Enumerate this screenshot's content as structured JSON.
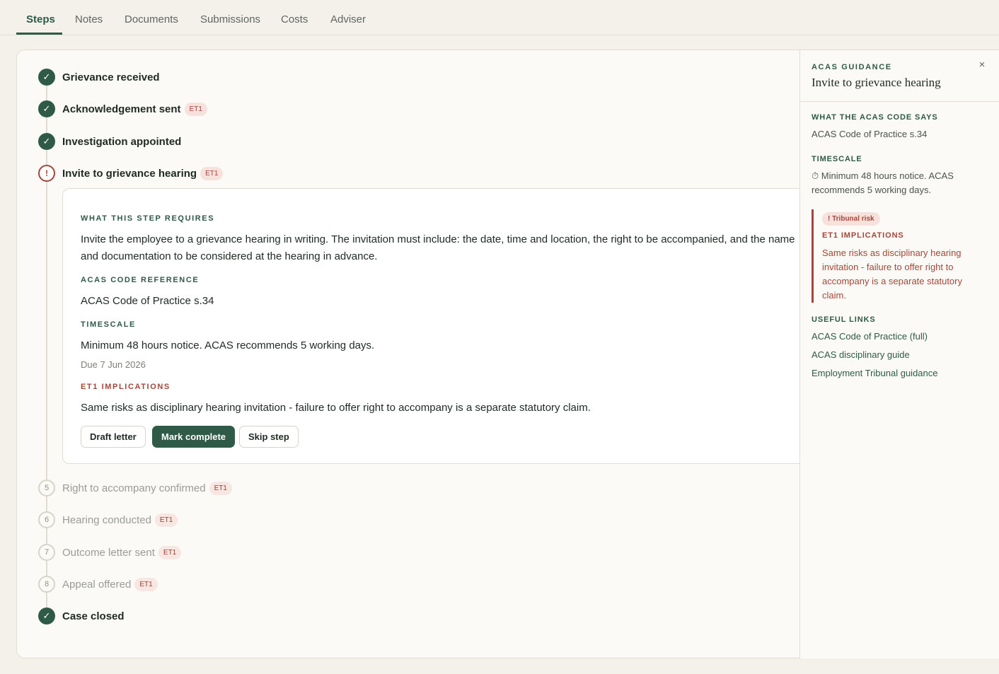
{
  "tabs": [
    {
      "label": "Steps"
    },
    {
      "label": "Notes"
    },
    {
      "label": "Documents"
    },
    {
      "label": "Submissions"
    },
    {
      "label": "Costs"
    },
    {
      "label": "Adviser"
    }
  ],
  "steps": [
    {
      "marker": "✓",
      "label": "Grievance received",
      "status": "done",
      "badge": ""
    },
    {
      "marker": "✓",
      "label": "Acknowledgement sent",
      "status": "done",
      "badge": "ET1"
    },
    {
      "marker": "✓",
      "label": "Investigation appointed",
      "status": "done",
      "badge": ""
    },
    {
      "marker": "!",
      "label": "Invite to grievance hearing",
      "status": "current",
      "badge": "ET1"
    },
    {
      "marker": "5",
      "label": "Right to accompany confirmed",
      "status": "pending",
      "badge": "ET1"
    },
    {
      "marker": "6",
      "label": "Hearing conducted",
      "status": "pending",
      "badge": "ET1"
    },
    {
      "marker": "7",
      "label": "Outcome letter sent",
      "status": "pending",
      "badge": "ET1"
    },
    {
      "marker": "8",
      "label": "Appeal offered",
      "status": "pending",
      "badge": "ET1"
    },
    {
      "marker": "✓",
      "label": "Case closed",
      "status": "done",
      "badge": ""
    }
  ],
  "detail": {
    "requires_heading": "WHAT THIS STEP REQUIRES",
    "requires_line1": "Invite the employee to a grievance hearing in writing. The invitation must include: the date, time and location, the right to be accompanied, and the name",
    "requires_line2": "and documentation to be considered at the hearing in advance.",
    "acas_heading": "ACAS CODE REFERENCE",
    "acas_text": "ACAS Code of Practice s.34",
    "timescale_heading": "TIMESCALE",
    "timescale_text": "Minimum 48 hours notice. ACAS recommends 5 working days.",
    "due": "Due 7 Jun 2026",
    "et1_heading": "ET1 IMPLICATIONS",
    "et1_text": "Same risks as disciplinary hearing invitation - failure to offer right to accompany is a separate statutory claim.",
    "buttons": {
      "draft": "Draft letter",
      "complete": "Mark complete",
      "skip": "Skip step"
    }
  },
  "side": {
    "kicker": "ACAS GUIDANCE",
    "title": "Invite to grievance hearing",
    "close": "×",
    "code_heading": "WHAT THE ACAS CODE SAYS",
    "code_text": "ACAS Code of Practice s.34",
    "timescale_heading": "TIMESCALE",
    "timescale_line1": "⏱ Minimum 48 hours notice. ACAS",
    "timescale_line2": "recommends 5 working days.",
    "risk_badge": "! Tribunal risk",
    "risk_heading": "ET1 IMPLICATIONS",
    "risk_text": "Same risks as disciplinary hearing invitation - failure to offer right to accompany is a separate statutory claim.",
    "links_heading": "USEFUL LINKS",
    "links": [
      "ACAS Code of Practice (full)",
      "ACAS disciplinary guide",
      "Employment Tribunal guidance"
    ]
  },
  "colors": {
    "brand_green": "#2f5a48",
    "risk_red": "#a4473a",
    "background": "#f4f1ea"
  }
}
